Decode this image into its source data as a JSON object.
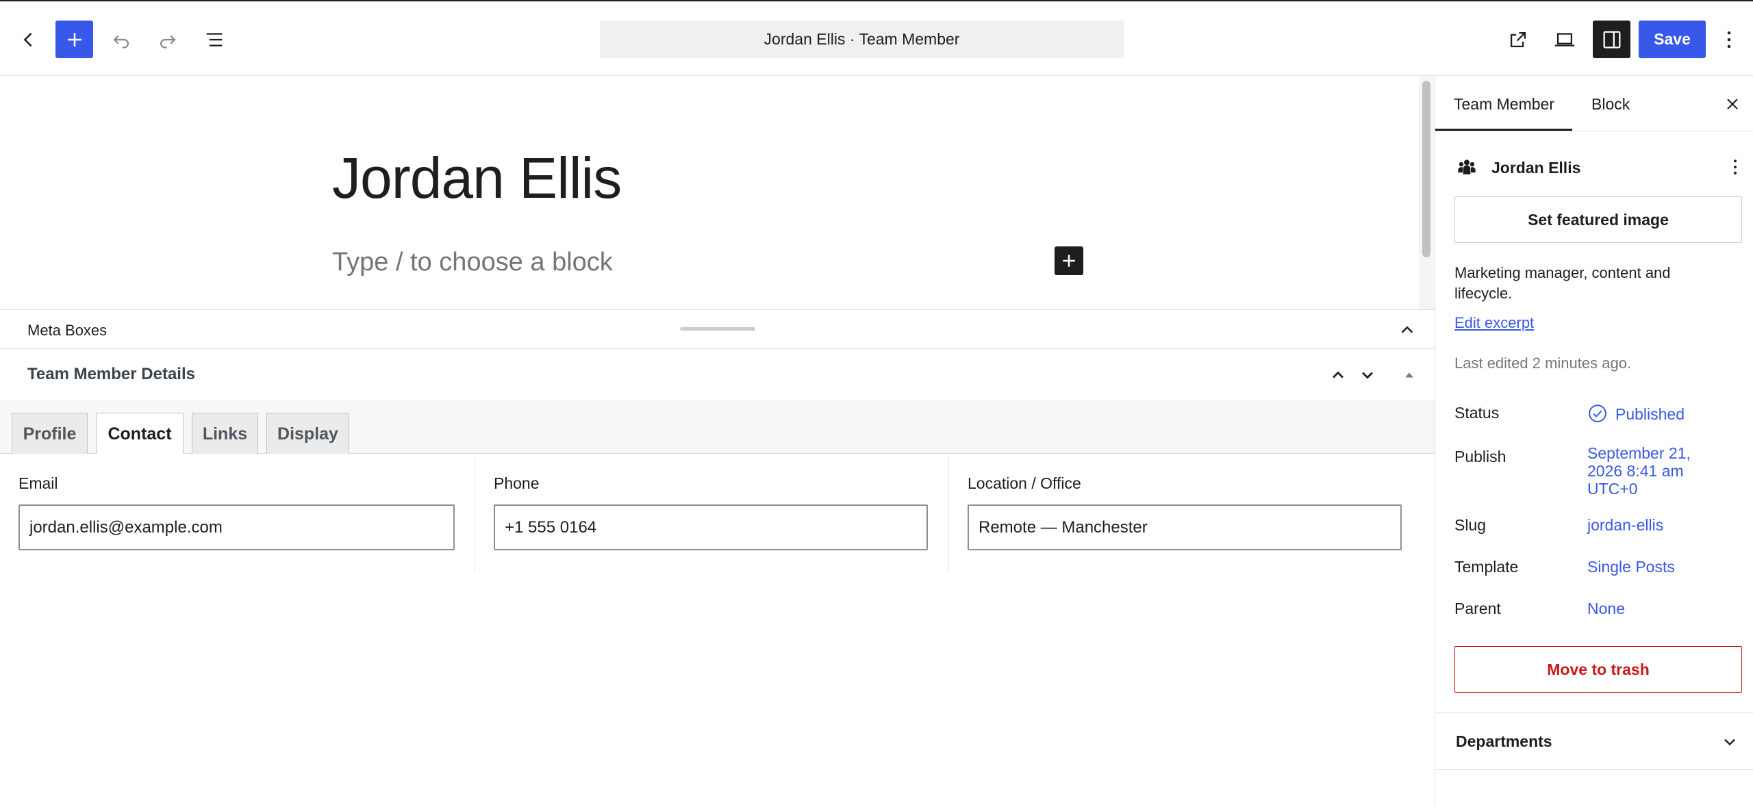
{
  "toolbar": {
    "document_title": "Jordan Ellis · Team Member",
    "save_label": "Save",
    "accent_color": "#3858e9",
    "icons": [
      "chevron-left-icon",
      "plus-icon",
      "undo-icon",
      "redo-icon",
      "list-view-icon",
      "external-link-icon",
      "device-preview-icon",
      "sidebar-toggle-icon",
      "more-vertical-icon"
    ]
  },
  "editor": {
    "post_title": "Jordan Ellis",
    "block_placeholder": "Type / to choose a block"
  },
  "meta_boxes": {
    "header_label": "Meta Boxes",
    "panel_title": "Team Member Details",
    "tabs": [
      {
        "label": "Profile",
        "active": false
      },
      {
        "label": "Contact",
        "active": true
      },
      {
        "label": "Links",
        "active": false
      },
      {
        "label": "Display",
        "active": false
      }
    ],
    "fields": {
      "email": {
        "label": "Email",
        "value": "jordan.ellis@example.com"
      },
      "phone": {
        "label": "Phone",
        "value": "+1 555 0164"
      },
      "location": {
        "label": "Location / Office",
        "value": "Remote — Manchester"
      }
    }
  },
  "sidebar": {
    "tabs": {
      "member": "Team Member",
      "block": "Block"
    },
    "post_name": "Jordan Ellis",
    "featured_image_label": "Set featured image",
    "excerpt": "Marketing manager, content and lifecycle.",
    "edit_excerpt_label": "Edit excerpt",
    "last_edited": "Last edited 2 minutes ago.",
    "rows": {
      "status": {
        "label": "Status",
        "value": "Published"
      },
      "publish": {
        "label": "Publish",
        "value": "September 21, 2026 8:41 am UTC+0"
      },
      "slug": {
        "label": "Slug",
        "value": "jordan-ellis"
      },
      "template": {
        "label": "Template",
        "value": "Single Posts"
      },
      "parent": {
        "label": "Parent",
        "value": "None"
      }
    },
    "trash_label": "Move to trash",
    "trash_color": "#cc1818",
    "departments_label": "Departments"
  }
}
